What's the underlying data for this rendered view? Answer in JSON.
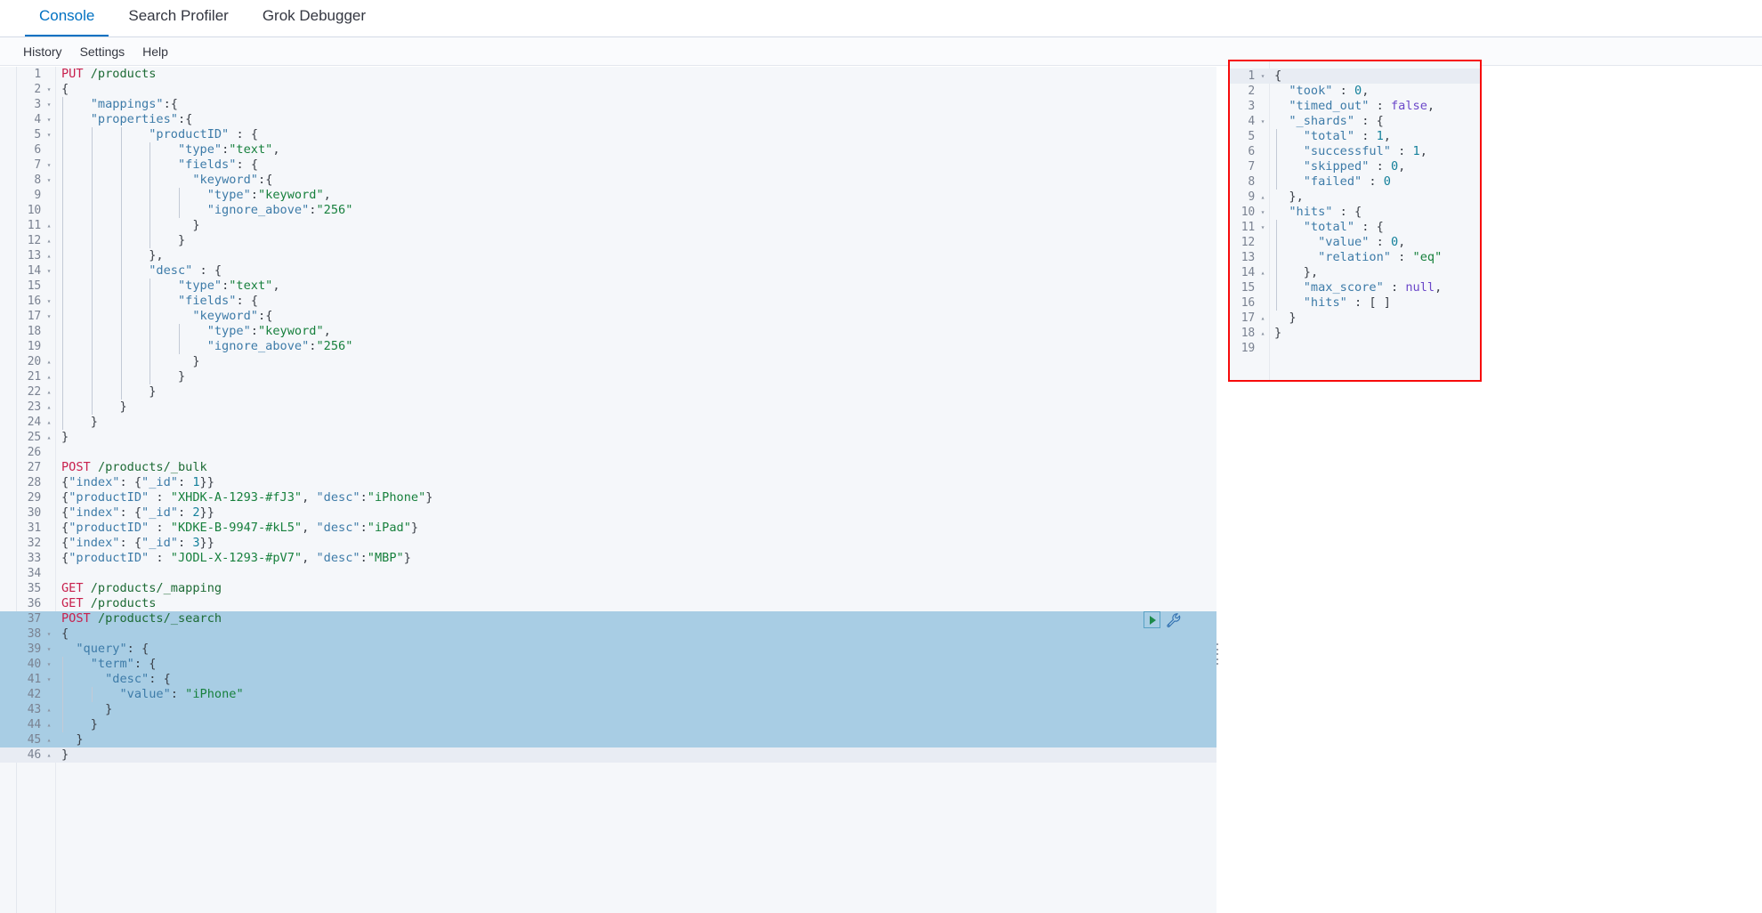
{
  "app_tabs": [
    {
      "label": "Console",
      "selected": true
    },
    {
      "label": "Search Profiler",
      "selected": false
    },
    {
      "label": "Grok Debugger",
      "selected": false
    }
  ],
  "menu_items": [
    {
      "label": "History"
    },
    {
      "label": "Settings"
    },
    {
      "label": "Help"
    }
  ],
  "colors": {
    "accent": "#0071c2",
    "method": "#c8204d",
    "url": "#1d6b35",
    "key": "#3d7ba8",
    "string": "#17803d",
    "number": "#14809b",
    "literal": "#6b47c9",
    "selection": "#a8cde4",
    "active_line": "#e8ecf3",
    "highlight_border": "#f70b0b",
    "editor_bg": "#f5f7fa"
  },
  "icons": {
    "play": "play-icon",
    "wrench": "wrench-icon",
    "drag_handle": "drag-handle-icon"
  },
  "request_editor": {
    "active_line": 46,
    "selected_lines": [
      37,
      38,
      39,
      40,
      41,
      42,
      43,
      44,
      45
    ],
    "lines": [
      {
        "n": 1,
        "fold": "",
        "text": "PUT /products"
      },
      {
        "n": 2,
        "fold": "▾",
        "text": "{"
      },
      {
        "n": 3,
        "fold": "▾",
        "text": "    \"mappings\":{"
      },
      {
        "n": 4,
        "fold": "▾",
        "text": "    \"properties\":{"
      },
      {
        "n": 5,
        "fold": "▾",
        "text": "            \"productID\" : {"
      },
      {
        "n": 6,
        "fold": "",
        "text": "                \"type\":\"text\","
      },
      {
        "n": 7,
        "fold": "▾",
        "text": "                \"fields\": {"
      },
      {
        "n": 8,
        "fold": "▾",
        "text": "                  \"keyword\":{"
      },
      {
        "n": 9,
        "fold": "",
        "text": "                    \"type\":\"keyword\","
      },
      {
        "n": 10,
        "fold": "",
        "text": "                    \"ignore_above\":\"256\""
      },
      {
        "n": 11,
        "fold": "▴",
        "text": "                  }"
      },
      {
        "n": 12,
        "fold": "▴",
        "text": "                }"
      },
      {
        "n": 13,
        "fold": "▴",
        "text": "            },"
      },
      {
        "n": 14,
        "fold": "▾",
        "text": "            \"desc\" : {"
      },
      {
        "n": 15,
        "fold": "",
        "text": "                \"type\":\"text\","
      },
      {
        "n": 16,
        "fold": "▾",
        "text": "                \"fields\": {"
      },
      {
        "n": 17,
        "fold": "▾",
        "text": "                  \"keyword\":{"
      },
      {
        "n": 18,
        "fold": "",
        "text": "                    \"type\":\"keyword\","
      },
      {
        "n": 19,
        "fold": "",
        "text": "                    \"ignore_above\":\"256\""
      },
      {
        "n": 20,
        "fold": "▴",
        "text": "                  }"
      },
      {
        "n": 21,
        "fold": "▴",
        "text": "                }"
      },
      {
        "n": 22,
        "fold": "▴",
        "text": "            }"
      },
      {
        "n": 23,
        "fold": "▴",
        "text": "        }"
      },
      {
        "n": 24,
        "fold": "▴",
        "text": "    }"
      },
      {
        "n": 25,
        "fold": "▴",
        "text": "}"
      },
      {
        "n": 26,
        "fold": "",
        "text": ""
      },
      {
        "n": 27,
        "fold": "",
        "text": "POST /products/_bulk"
      },
      {
        "n": 28,
        "fold": "",
        "text": "{\"index\": {\"_id\": 1}}"
      },
      {
        "n": 29,
        "fold": "",
        "text": "{\"productID\" : \"XHDK-A-1293-#fJ3\", \"desc\":\"iPhone\"}"
      },
      {
        "n": 30,
        "fold": "",
        "text": "{\"index\": {\"_id\": 2}}"
      },
      {
        "n": 31,
        "fold": "",
        "text": "{\"productID\" : \"KDKE-B-9947-#kL5\", \"desc\":\"iPad\"}"
      },
      {
        "n": 32,
        "fold": "",
        "text": "{\"index\": {\"_id\": 3}}"
      },
      {
        "n": 33,
        "fold": "",
        "text": "{\"productID\" : \"JODL-X-1293-#pV7\", \"desc\":\"MBP\"}"
      },
      {
        "n": 34,
        "fold": "",
        "text": ""
      },
      {
        "n": 35,
        "fold": "",
        "text": "GET /products/_mapping"
      },
      {
        "n": 36,
        "fold": "",
        "text": "GET /products"
      },
      {
        "n": 37,
        "fold": "",
        "text": "POST /products/_search"
      },
      {
        "n": 38,
        "fold": "▾",
        "text": "{"
      },
      {
        "n": 39,
        "fold": "▾",
        "text": "  \"query\": {"
      },
      {
        "n": 40,
        "fold": "▾",
        "text": "    \"term\": {"
      },
      {
        "n": 41,
        "fold": "▾",
        "text": "      \"desc\": {"
      },
      {
        "n": 42,
        "fold": "",
        "text": "        \"value\": \"iPhone\""
      },
      {
        "n": 43,
        "fold": "▴",
        "text": "      }"
      },
      {
        "n": 44,
        "fold": "▴",
        "text": "    }"
      },
      {
        "n": 45,
        "fold": "▴",
        "text": "  }"
      },
      {
        "n": 46,
        "fold": "▴",
        "text": "}"
      }
    ]
  },
  "response_editor": {
    "active_line": 1,
    "lines": [
      {
        "n": 1,
        "fold": "▾",
        "text": "{"
      },
      {
        "n": 2,
        "fold": "",
        "text": "  \"took\" : 0,"
      },
      {
        "n": 3,
        "fold": "",
        "text": "  \"timed_out\" : false,"
      },
      {
        "n": 4,
        "fold": "▾",
        "text": "  \"_shards\" : {"
      },
      {
        "n": 5,
        "fold": "",
        "text": "    \"total\" : 1,"
      },
      {
        "n": 6,
        "fold": "",
        "text": "    \"successful\" : 1,"
      },
      {
        "n": 7,
        "fold": "",
        "text": "    \"skipped\" : 0,"
      },
      {
        "n": 8,
        "fold": "",
        "text": "    \"failed\" : 0"
      },
      {
        "n": 9,
        "fold": "▴",
        "text": "  },"
      },
      {
        "n": 10,
        "fold": "▾",
        "text": "  \"hits\" : {"
      },
      {
        "n": 11,
        "fold": "▾",
        "text": "    \"total\" : {"
      },
      {
        "n": 12,
        "fold": "",
        "text": "      \"value\" : 0,"
      },
      {
        "n": 13,
        "fold": "",
        "text": "      \"relation\" : \"eq\""
      },
      {
        "n": 14,
        "fold": "▴",
        "text": "    },"
      },
      {
        "n": 15,
        "fold": "",
        "text": "    \"max_score\" : null,"
      },
      {
        "n": 16,
        "fold": "",
        "text": "    \"hits\" : [ ]"
      },
      {
        "n": 17,
        "fold": "▴",
        "text": "  }"
      },
      {
        "n": 18,
        "fold": "▴",
        "text": "}"
      },
      {
        "n": 19,
        "fold": "",
        "text": ""
      }
    ]
  }
}
